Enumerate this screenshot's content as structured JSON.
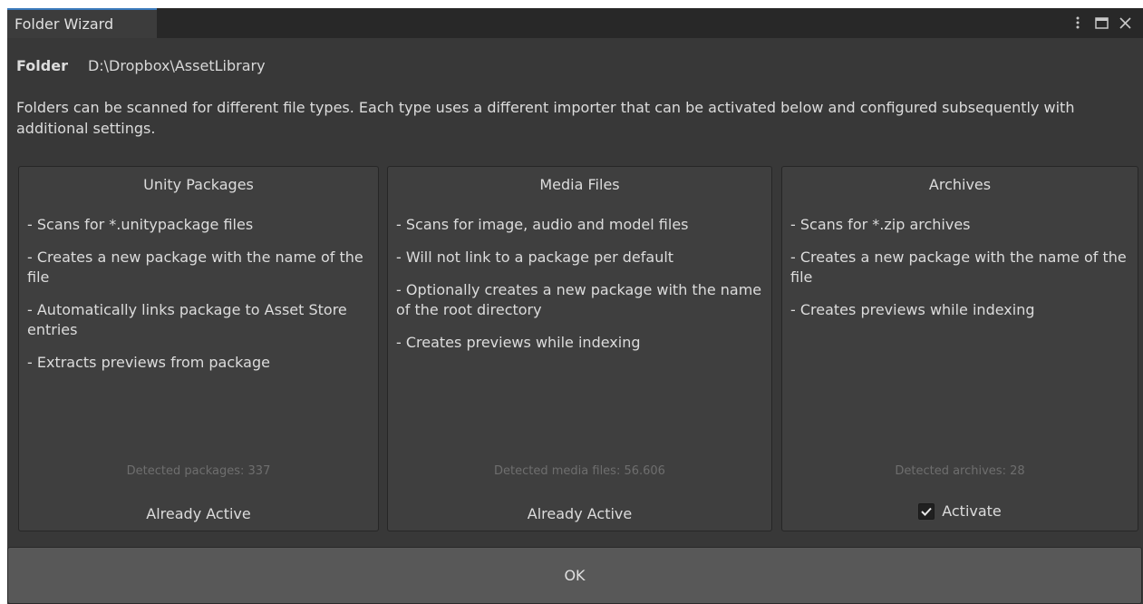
{
  "window": {
    "tab_title": "Folder Wizard"
  },
  "folder": {
    "label": "Folder",
    "path": "D:\\Dropbox\\AssetLibrary"
  },
  "description": "Folders can be scanned for different file types. Each type uses a different importer that can be activated below and configured subsequently with additional settings.",
  "cards": [
    {
      "title": "Unity Packages",
      "features": [
        "- Scans for *.unitypackage files",
        "- Creates a new package with the name of the file",
        "- Automatically links package to Asset Store entries",
        "- Extracts previews from package"
      ],
      "detected": "Detected packages: 337",
      "status": "Already Active"
    },
    {
      "title": "Media Files",
      "features": [
        "- Scans for image, audio and model files",
        "- Will not link to a package per default",
        "- Optionally creates a new package with the name of the root directory",
        "- Creates previews while indexing"
      ],
      "detected": "Detected media files: 56.606",
      "status": "Already Active"
    },
    {
      "title": "Archives",
      "features": [
        "- Scans for *.zip archives",
        "- Creates a new package with the name of the file",
        "- Creates previews while indexing"
      ],
      "detected": "Detected archives: 28",
      "activate_label": "Activate",
      "activate_checked": true
    }
  ],
  "ok_label": "OK",
  "colors": {
    "background": "#383838",
    "card": "#3f3f3f",
    "tab_accent": "#3a79bb",
    "button": "#585858"
  },
  "icons": {
    "menu": "kebab-menu-icon",
    "maximize": "maximize-icon",
    "close": "close-icon",
    "checkbox": "checkmark-icon"
  }
}
